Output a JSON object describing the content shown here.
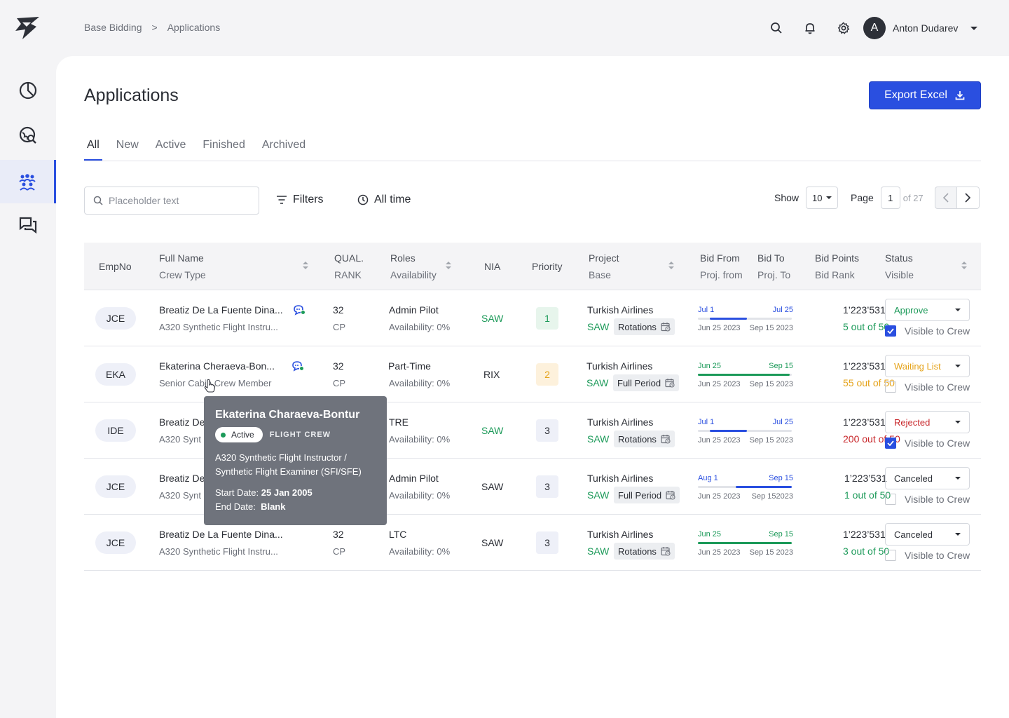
{
  "breadcrumb": {
    "parent": "Base Bidding",
    "separator": ">",
    "current": "Applications"
  },
  "user": {
    "initial": "A",
    "name": "Anton Dudarev"
  },
  "page": {
    "title": "Applications",
    "export_label": "Export Excel"
  },
  "tabs": [
    "All",
    "New",
    "Active",
    "Finished",
    "Archived"
  ],
  "search": {
    "placeholder": "Placeholder text"
  },
  "toolbar": {
    "filters_label": "Filters",
    "time_label": "All time"
  },
  "pager": {
    "show_label": "Show",
    "show_value": "10",
    "page_label": "Page",
    "page_value": "1",
    "of_label": "of 27"
  },
  "columns": {
    "empno": "EmpNo",
    "fullname": "Full Name",
    "crewtype": "Crew Type",
    "qual": "QUAL.",
    "rank": "RANK",
    "roles": "Roles",
    "availability": "Availability",
    "nia": "NIA",
    "priority": "Priority",
    "project": "Project",
    "base": "Base",
    "bidfrom": "Bid From",
    "projfrom": "Proj. from",
    "bidto": "Bid To",
    "projto": "Proj. To",
    "bidpoints": "Bid Points",
    "bidrank": "Bid Rank",
    "status": "Status",
    "visible": "Visible"
  },
  "colors": {
    "accent": "#2a4fe0",
    "green": "#1c9a59",
    "orange": "#e5a31a",
    "red": "#c8262a"
  },
  "rows": [
    {
      "emp": "JCE",
      "name": "Breatiz De La Fuente Dina...",
      "crew": "A320 Synthetic Flight Instru...",
      "qual": "32",
      "rank": "CP",
      "role": "Admin Pilot",
      "avail": "Availability: 0%",
      "nia": "SAW",
      "nia_color": "green",
      "priority": "1",
      "prio_style": "green",
      "project": "Turkish Airlines",
      "base": "SAW",
      "chip": "Rotations",
      "bid_from": "Jul 1",
      "bid_to": "Jul 25",
      "bar_color": "blue",
      "bar_start": 0.13,
      "bar_end": 0.52,
      "proj_from": "Jun 25 2023",
      "proj_to": "Sep 15 2023",
      "points": "1’223’531",
      "bidrank": "5 out of 50",
      "rank_color": "green",
      "status": "Approve",
      "status_color": "green",
      "visible": true,
      "visible_label": "Visible to Crew"
    },
    {
      "emp": "EKA",
      "name": "Ekaterina Cheraeva-Bon...",
      "crew": "Senior Cabin Crew Member",
      "qual": "32",
      "rank": "CP",
      "role": "Part-Time",
      "avail": "Availability: 0%",
      "nia": "RIX",
      "nia_color": "dark",
      "priority": "2",
      "prio_style": "orange",
      "project": "Turkish Airlines",
      "base": "SAW",
      "chip": "Full Period",
      "bid_from": "Jun 25",
      "bid_to": "Sep 15",
      "bar_color": "green",
      "bar_start": 0.0,
      "bar_end": 0.98,
      "proj_from": "Jun 25 2023",
      "proj_to": "Sep 15 2023",
      "points": "1’223’531",
      "bidrank": "55 out of 50",
      "rank_color": "orange",
      "status": "Waiting List",
      "status_color": "orange",
      "visible": false,
      "visible_label": "Visible to Crew"
    },
    {
      "emp": "IDE",
      "name": "Breatiz De",
      "crew": "A320 Synt",
      "qual": "",
      "rank": "",
      "role": "TRE",
      "avail": "Availability: 0%",
      "nia": "SAW",
      "nia_color": "green",
      "priority": "3",
      "prio_style": "gray",
      "project": "Turkish Airlines",
      "base": "SAW",
      "chip": "Rotations",
      "bid_from": "Jul 1",
      "bid_to": "Jul 25",
      "bar_color": "blue",
      "bar_start": 0.13,
      "bar_end": 0.52,
      "proj_from": "Jun 25 2023",
      "proj_to": "Sep 15 2023",
      "points": "1’223’531",
      "bidrank": "200 out of 50",
      "rank_color": "red",
      "status": "Rejected",
      "status_color": "red",
      "visible": true,
      "visible_label": "Visible to Crew"
    },
    {
      "emp": "JCE",
      "name": "Breatiz De",
      "crew": "A320 Synt",
      "qual": "",
      "rank": "",
      "role": "Admin Pilot",
      "avail": "Availability: 0%",
      "nia": "SAW",
      "nia_color": "dark",
      "priority": "3",
      "prio_style": "gray",
      "project": "Turkish Airlines",
      "base": "SAW",
      "chip": "Full Period",
      "bid_from": "Aug 1",
      "bid_to": "Sep 15",
      "bar_color": "blue",
      "bar_start": 0.4,
      "bar_end": 1.0,
      "proj_from": "Jun 25 2023",
      "proj_to": "Sep 152023",
      "points": "1’223’531",
      "bidrank": "1 out of 50",
      "rank_color": "green",
      "status": "Canceled",
      "status_color": "dark",
      "visible": false,
      "visible_label": "Visible to Crew"
    },
    {
      "emp": "JCE",
      "name": "Breatiz De La Fuente Dina...",
      "crew": "A320 Synthetic Flight Instru...",
      "qual": "32",
      "rank": "CP",
      "role": "LTC",
      "avail": "Availability: 0%",
      "nia": "SAW",
      "nia_color": "dark",
      "priority": "3",
      "prio_style": "gray",
      "project": "Turkish Airlines",
      "base": "SAW",
      "chip": "Rotations",
      "bid_from": "Jun 25",
      "bid_to": "Sep 15",
      "bar_color": "green",
      "bar_start": 0.0,
      "bar_end": 1.0,
      "proj_from": "Jun 25 2023",
      "proj_to": "Sep 15 2023",
      "points": "1’223’531",
      "bidrank": "3 out of 50",
      "rank_color": "green",
      "status": "Canceled",
      "status_color": "dark",
      "visible": false,
      "visible_label": "Visible to Crew"
    }
  ],
  "tooltip": {
    "name": "Ekaterina Charaeva-Bontur",
    "status": "Active",
    "crew_label": "FLIGHT CREW",
    "role": "A320 Synthetic Flight Instructor / Synthetic Flight Examiner (SFI/SFE)",
    "start_label": "Start Date:",
    "start_value": "25 Jan 2005",
    "end_label": "End Date:",
    "end_value": "Blank"
  }
}
